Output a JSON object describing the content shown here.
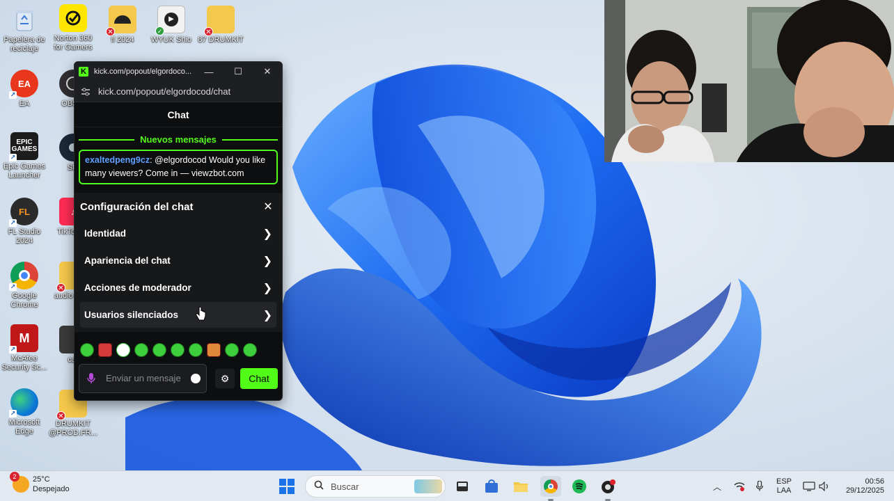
{
  "desktop": {
    "icons": [
      {
        "label": "Papelera de reciclaje",
        "icon": "recycle-bin-icon"
      },
      {
        "label": "Norton 360 for Gamers",
        "icon": "norton-icon"
      },
      {
        "label": "fl 2024",
        "icon": "folder-icon"
      },
      {
        "label": "WYUK Shio",
        "icon": "media-file-icon"
      },
      {
        "label": "87 DRUMKIT",
        "icon": "folder-icon"
      },
      {
        "label": "EA",
        "icon": "ea-icon"
      },
      {
        "label": "OBS S",
        "icon": "obs-icon"
      },
      {
        "label": "Epic Games Launcher",
        "icon": "epic-games-icon"
      },
      {
        "label": "Ste",
        "icon": "steam-icon"
      },
      {
        "label": "FL Studio 2024",
        "icon": "fl-studio-icon"
      },
      {
        "label": "TikTo Stu",
        "icon": "tiktok-icon"
      },
      {
        "label": "Google Chrome",
        "icon": "chrome-icon"
      },
      {
        "label": "audio de fa",
        "icon": "folder-icon"
      },
      {
        "label": "McAfee Security Sc...",
        "icon": "mcafee-icon"
      },
      {
        "label": "car",
        "icon": "file-icon"
      },
      {
        "label": "Microsoft Edge",
        "icon": "edge-icon"
      },
      {
        "label": "DRUMKIT @PROD.FR...",
        "icon": "folder-icon"
      }
    ]
  },
  "popout": {
    "window_title": "kick.com/popout/elgordoco...",
    "url": "kick.com/popout/elgordocod/chat",
    "header": "Chat",
    "new_messages": "Nuevos mensajes",
    "message": {
      "user": "exaltedpeng9cz",
      "text": ": @elgordocod Would you like many viewers? Come in — viewzbot.com"
    },
    "settings": {
      "title": "Configuración del chat",
      "items": [
        {
          "label": "Identidad"
        },
        {
          "label": "Apariencia del chat"
        },
        {
          "label": "Acciones de moderador"
        },
        {
          "label": "Usuarios silenciados"
        }
      ]
    },
    "input_placeholder": "Enviar un mensaje",
    "send_label": "Chat",
    "accent": "#53fc18"
  },
  "taskbar": {
    "weather_temp": "25°C",
    "weather_desc": "Despejado",
    "weather_badge": "2",
    "search_placeholder": "Buscar",
    "lang_top": "ESP",
    "lang_bottom": "LAA",
    "time": "00:56",
    "date": "29/12/2025"
  }
}
